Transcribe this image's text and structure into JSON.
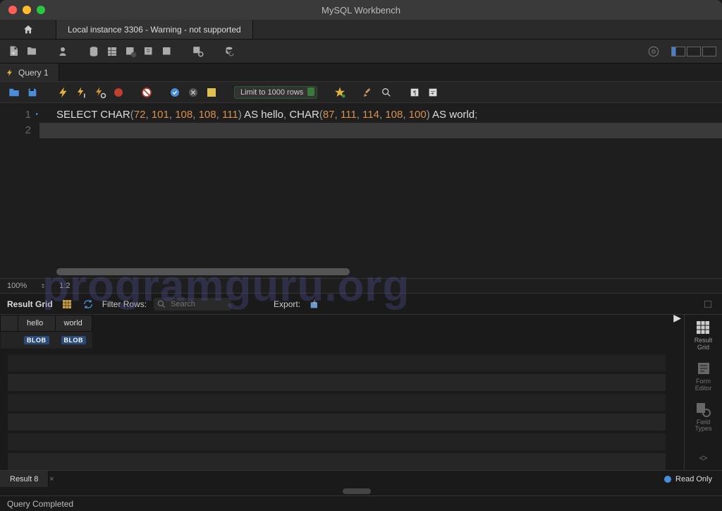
{
  "title": "MySQL Workbench",
  "connection_tab": "Local instance 3306 - Warning - not supported",
  "query_tab": "Query 1",
  "limit_dropdown": "Limit to 1000 rows",
  "editor": {
    "lines": [
      "1",
      "2"
    ],
    "sql_tokens": {
      "select": "SELECT",
      "char1": "CHAR",
      "n1": "72",
      "n2": "101",
      "n3": "108",
      "n4": "108",
      "n5": "111",
      "as1": "AS",
      "alias1": "hello",
      "char2": "CHAR",
      "n6": "87",
      "n7": "111",
      "n8": "114",
      "n9": "108",
      "n10": "100",
      "as2": "AS",
      "alias2": "world"
    }
  },
  "zoom": "100%",
  "cursor_pos": "1:2",
  "result_toolbar": {
    "label": "Result Grid",
    "filter_label": "Filter Rows:",
    "filter_placeholder": "Search",
    "export_label": "Export:"
  },
  "result": {
    "columns": [
      "hello",
      "world"
    ],
    "rows": [
      {
        "hello": "BLOB",
        "world": "BLOB"
      }
    ]
  },
  "side_panel": {
    "result_grid": "Result\nGrid",
    "form_editor": "Form\nEditor",
    "field_types": "Field\nTypes"
  },
  "result_tab": "Result 8",
  "readonly": "Read Only",
  "footer": "Query Completed",
  "watermark": "programguru.org"
}
